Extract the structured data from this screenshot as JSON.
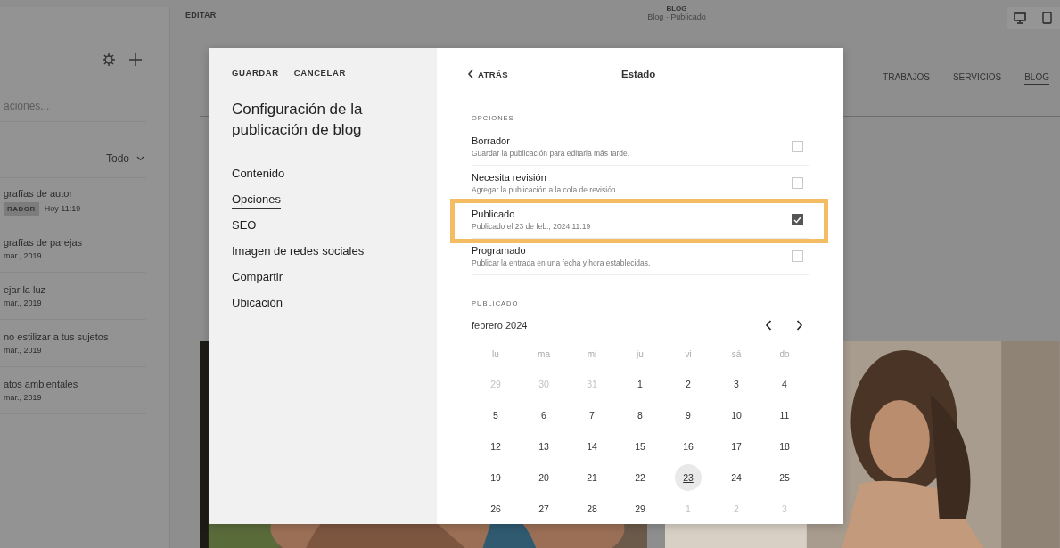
{
  "sidebar": {
    "search": {
      "placeholder": "aciones..."
    },
    "filter": "Todo",
    "posts": [
      {
        "title": "grafías de autor",
        "badge": "RADOR",
        "meta": "Hoy 11:19"
      },
      {
        "title": "grafías de parejas",
        "meta": "mar., 2019"
      },
      {
        "title": "ejar la luz",
        "meta": "mar., 2019"
      },
      {
        "title": "no estilizar a tus sujetos",
        "meta": "mar., 2019"
      },
      {
        "title": "atos ambientales",
        "meta": "mar., 2019"
      }
    ]
  },
  "topbar": {
    "mode": "EDITAR",
    "title": "BLOG",
    "subtitle": "Blog · Publicado"
  },
  "site_nav": [
    {
      "label": "TRABAJOS",
      "selected": false
    },
    {
      "label": "SERVICIOS",
      "selected": false
    },
    {
      "label": "BLOG",
      "selected": true
    }
  ],
  "dialog": {
    "actions": [
      "GUARDAR",
      "CANCELAR"
    ],
    "title": "Configuración de la publicación de blog",
    "menu": [
      {
        "label": "Contenido",
        "selected": false
      },
      {
        "label": "Opciones",
        "selected": true
      },
      {
        "label": "SEO",
        "selected": false
      },
      {
        "label": "Imagen de redes sociales",
        "selected": false
      },
      {
        "label": "Compartir",
        "selected": false
      },
      {
        "label": "Ubicación",
        "selected": false
      }
    ],
    "back": "ATRÁS",
    "panel_title": "Estado",
    "options_heading": "OPCIONES",
    "options": [
      {
        "label": "Borrador",
        "description": "Guardar la publicación para editarla más tarde.",
        "checked": false,
        "highlighted": false
      },
      {
        "label": "Necesita revisión",
        "description": "Agregar la publicación a la cola de revisión.",
        "checked": false,
        "highlighted": false
      },
      {
        "label": "Publicado",
        "description": "Publicado el 23 de feb., 2024 11:19",
        "checked": true,
        "highlighted": true
      },
      {
        "label": "Programado",
        "description": "Publicar la entrada en una fecha y hora establecidas.",
        "checked": false,
        "highlighted": false
      }
    ],
    "calendar": {
      "heading": "PUBLICADO",
      "month": "febrero 2024",
      "weekdays": [
        "lu",
        "ma",
        "mi",
        "ju",
        "vi",
        "sá",
        "do"
      ],
      "weeks": [
        [
          {
            "day": "29",
            "outside": true,
            "selected": false
          },
          {
            "day": "30",
            "outside": true,
            "selected": false
          },
          {
            "day": "31",
            "outside": true,
            "selected": false
          },
          {
            "day": "1",
            "outside": false,
            "selected": false
          },
          {
            "day": "2",
            "outside": false,
            "selected": false
          },
          {
            "day": "3",
            "outside": false,
            "selected": false
          },
          {
            "day": "4",
            "outside": false,
            "selected": false
          }
        ],
        [
          {
            "day": "5",
            "outside": false,
            "selected": false
          },
          {
            "day": "6",
            "outside": false,
            "selected": false
          },
          {
            "day": "7",
            "outside": false,
            "selected": false
          },
          {
            "day": "8",
            "outside": false,
            "selected": false
          },
          {
            "day": "9",
            "outside": false,
            "selected": false
          },
          {
            "day": "10",
            "outside": false,
            "selected": false
          },
          {
            "day": "11",
            "outside": false,
            "selected": false
          }
        ],
        [
          {
            "day": "12",
            "outside": false,
            "selected": false
          },
          {
            "day": "13",
            "outside": false,
            "selected": false
          },
          {
            "day": "14",
            "outside": false,
            "selected": false
          },
          {
            "day": "15",
            "outside": false,
            "selected": false
          },
          {
            "day": "16",
            "outside": false,
            "selected": false
          },
          {
            "day": "17",
            "outside": false,
            "selected": false
          },
          {
            "day": "18",
            "outside": false,
            "selected": false
          }
        ],
        [
          {
            "day": "19",
            "outside": false,
            "selected": false
          },
          {
            "day": "20",
            "outside": false,
            "selected": false
          },
          {
            "day": "21",
            "outside": false,
            "selected": false
          },
          {
            "day": "22",
            "outside": false,
            "selected": false
          },
          {
            "day": "23",
            "outside": false,
            "selected": true
          },
          {
            "day": "24",
            "outside": false,
            "selected": false
          },
          {
            "day": "25",
            "outside": false,
            "selected": false
          }
        ],
        [
          {
            "day": "26",
            "outside": false,
            "selected": false
          },
          {
            "day": "27",
            "outside": false,
            "selected": false
          },
          {
            "day": "28",
            "outside": false,
            "selected": false
          },
          {
            "day": "29",
            "outside": false,
            "selected": false
          },
          {
            "day": "1",
            "outside": true,
            "selected": false
          },
          {
            "day": "2",
            "outside": true,
            "selected": false
          },
          {
            "day": "3",
            "outside": true,
            "selected": false
          }
        ]
      ]
    }
  }
}
